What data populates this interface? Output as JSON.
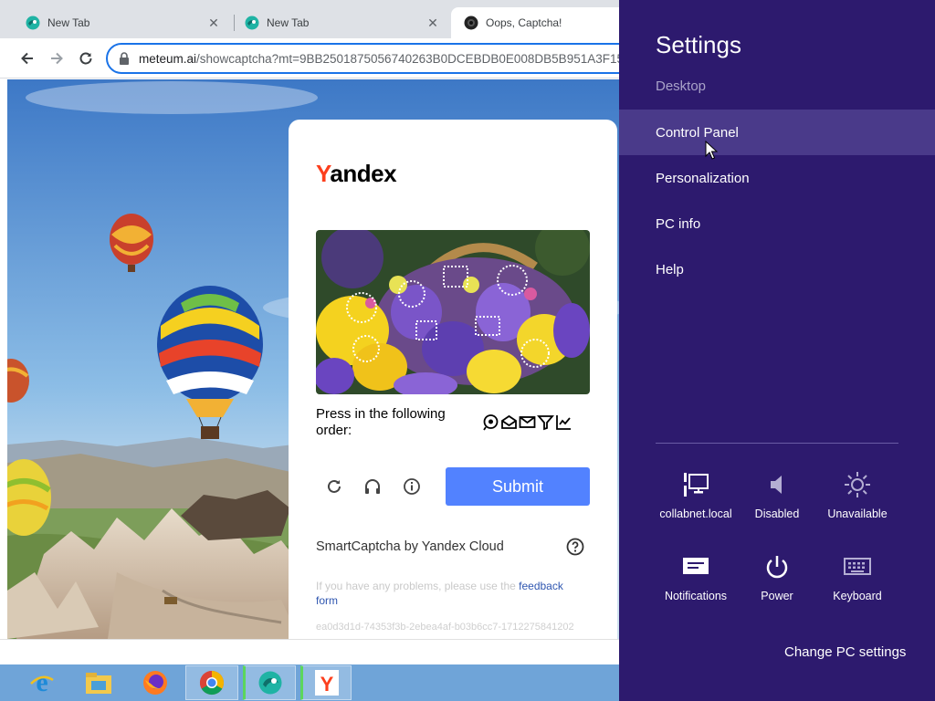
{
  "browser": {
    "tabs": [
      {
        "label": "New Tab",
        "active": false
      },
      {
        "label": "New Tab",
        "active": false
      },
      {
        "label": "Oops, Captcha!",
        "active": true
      }
    ],
    "address": {
      "domain": "meteum.ai",
      "path": "/showcaptcha?mt=9BB2501875056740263B0DCEBDB0E008DB5B951A3F15"
    }
  },
  "captcha": {
    "logo_first": "Y",
    "logo_rest": "andex",
    "instruction": "Press in the following order:",
    "submit_label": "Submit",
    "brand": "SmartCaptcha by Yandex Cloud",
    "problems_text": "If you have any problems, please use the ",
    "problems_link": "feedback form",
    "token": "ea0d3d1d-74353f3b-2ebea4af-b03b6cc7-1712275841202",
    "order_icons": [
      "smile-pin-icon",
      "envelope-open-icon",
      "envelope-icon",
      "funnel-icon",
      "chart-icon"
    ]
  },
  "settings": {
    "title": "Settings",
    "subtitle": "Desktop",
    "items": [
      {
        "label": "Control Panel"
      },
      {
        "label": "Personalization"
      },
      {
        "label": "PC info"
      },
      {
        "label": "Help"
      }
    ],
    "quick": [
      {
        "label": "collabnet.local",
        "icon": "network-icon"
      },
      {
        "label": "Disabled",
        "icon": "volume-icon"
      },
      {
        "label": "Unavailable",
        "icon": "brightness-icon"
      },
      {
        "label": "Notifications",
        "icon": "notifications-icon"
      },
      {
        "label": "Power",
        "icon": "power-icon"
      },
      {
        "label": "Keyboard",
        "icon": "keyboard-icon"
      }
    ],
    "change_pc": "Change PC settings",
    "colors": {
      "background": "#2d1a6e",
      "hover": "#4a3a8a"
    }
  },
  "taskbar": {
    "items": [
      "internet-explorer-icon",
      "file-explorer-icon",
      "firefox-icon",
      "chrome-icon",
      "app-icon",
      "yandex-icon"
    ]
  }
}
